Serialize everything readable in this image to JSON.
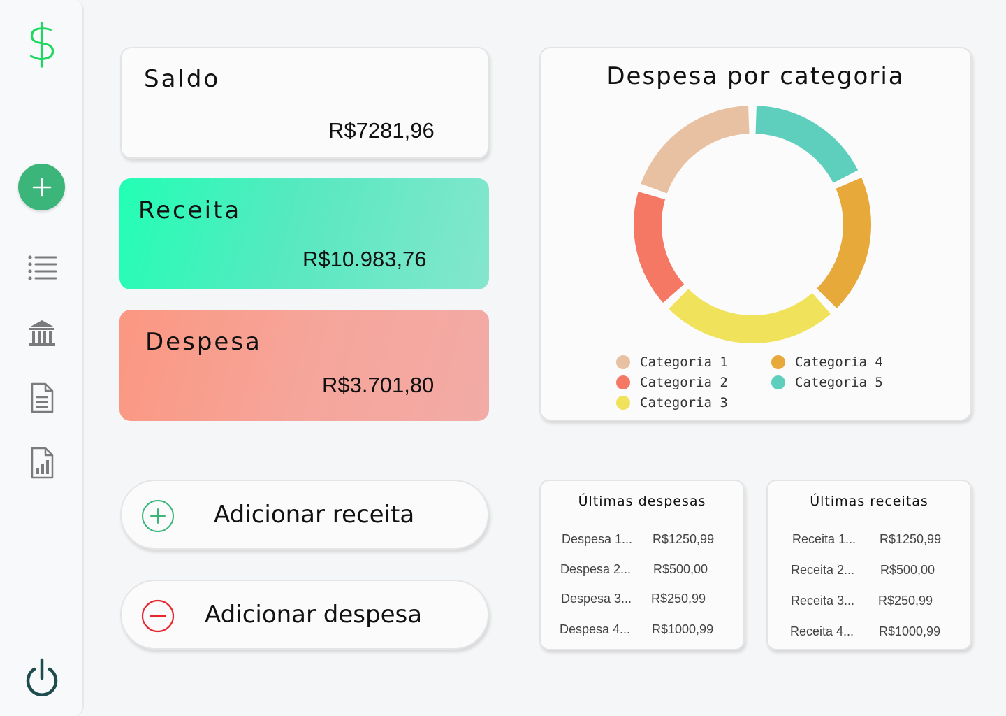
{
  "sidebar": {
    "logo": "$",
    "items": [
      {
        "icon": "list-icon"
      },
      {
        "icon": "bank-icon"
      },
      {
        "icon": "document-icon"
      },
      {
        "icon": "report-chart-icon"
      }
    ],
    "add_icon": "plus-icon",
    "logout_icon": "power-icon"
  },
  "summary": {
    "saldo": {
      "label": "Saldo",
      "value": "R$7281,96"
    },
    "receita": {
      "label": "Receita",
      "value": "R$10.983,76"
    },
    "despesa": {
      "label": "Despesa",
      "value": "R$3.701,80"
    }
  },
  "actions": {
    "add_income": "Adicionar receita",
    "add_expense": "Adicionar despesa"
  },
  "chart_data": {
    "type": "pie",
    "donut": true,
    "title": "Despesa por categoria",
    "categories": [
      "Categoria 1",
      "Categoria 2",
      "Categoria 3",
      "Categoria 4",
      "Categoria 5"
    ],
    "values": [
      20,
      17,
      25,
      20,
      18
    ],
    "colors": [
      "#e8c1a2",
      "#f47864",
      "#f0e25a",
      "#e6a93a",
      "#5fcfbd"
    ],
    "legend_position": "bottom"
  },
  "latest_expenses": {
    "title": "Últimas despesas",
    "rows": [
      {
        "name": "Despesa 1...",
        "amount": "R$1250,99"
      },
      {
        "name": "Despesa 2...",
        "amount": "R$500,00"
      },
      {
        "name": "Despesa 3...",
        "amount": "R$250,99"
      },
      {
        "name": "Despesa 4...",
        "amount": "R$1000,99"
      }
    ]
  },
  "latest_incomes": {
    "title": "Últimas receitas",
    "rows": [
      {
        "name": "Receita 1...",
        "amount": "R$1250,99"
      },
      {
        "name": "Receita 2...",
        "amount": "R$500,00"
      },
      {
        "name": "Receita 3...",
        "amount": "R$250,99"
      },
      {
        "name": "Receita 4...",
        "amount": "R$1000,99"
      }
    ]
  }
}
